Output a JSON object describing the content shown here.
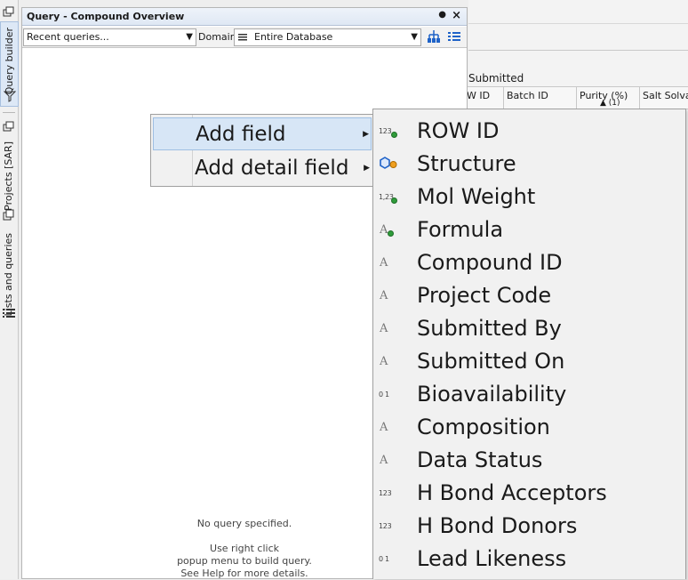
{
  "sidebar": {
    "tabs": [
      {
        "label": "Query builder",
        "active": true
      },
      {
        "label": "Projects [SAR]",
        "active": false
      },
      {
        "label": "Lists and queries",
        "active": false
      }
    ]
  },
  "query_panel": {
    "title": "Query - Compound Overview",
    "pin_icon": "pin-dot-icon",
    "close_glyph": "×",
    "recent_queries": "Recent queries...",
    "domain_label": "Domain:",
    "domain_value": "Entire Database",
    "empty_line1": "No query specified.",
    "empty_line2": "Use right click",
    "empty_line3": "popup menu to build query.",
    "empty_line4": "See Help for more details."
  },
  "background_table": {
    "section_label": "Submitted",
    "columns": [
      "W ID",
      "Batch ID",
      "Purity (%)",
      "Salt Solvat"
    ],
    "sort_indicator": "▲ (1)"
  },
  "context_menu": {
    "items": [
      {
        "label": "Add field",
        "has_submenu": true,
        "highlighted": true
      },
      {
        "label": "Add detail field",
        "has_submenu": true,
        "highlighted": false
      }
    ]
  },
  "submenu": {
    "items": [
      {
        "label": "ROW ID",
        "icon": "integer-key-icon"
      },
      {
        "label": "Structure",
        "icon": "structure-icon"
      },
      {
        "label": "Mol Weight",
        "icon": "decimal-key-icon"
      },
      {
        "label": "Formula",
        "icon": "text-key-icon"
      },
      {
        "label": "Compound ID",
        "icon": "text-icon"
      },
      {
        "label": "Project Code",
        "icon": "text-icon"
      },
      {
        "label": "Submitted By",
        "icon": "text-icon"
      },
      {
        "label": "Submitted On",
        "icon": "text-icon"
      },
      {
        "label": "Bioavailability",
        "icon": "boolean-icon"
      },
      {
        "label": "Composition",
        "icon": "text-icon"
      },
      {
        "label": "Data Status",
        "icon": "text-icon"
      },
      {
        "label": "H Bond Acceptors",
        "icon": "integer-icon"
      },
      {
        "label": "H Bond Donors",
        "icon": "integer-icon"
      },
      {
        "label": "Lead Likeness",
        "icon": "boolean-icon"
      }
    ],
    "icon_glyphs": {
      "text": "A",
      "integer": "123",
      "decimal": "1,23",
      "boolean": "0 1"
    }
  },
  "colors": {
    "key_dot": "#2f9c3a",
    "accent": "#1e62c8",
    "highlight": "#d7e6f6"
  }
}
